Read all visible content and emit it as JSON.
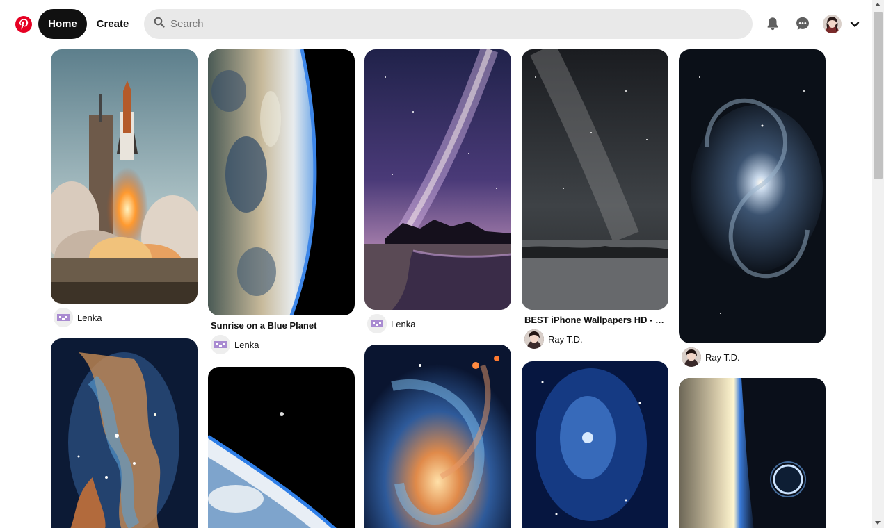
{
  "header": {
    "logo_icon": "pinterest-logo-icon",
    "home_label": "Home",
    "create_label": "Create",
    "search_placeholder": "Search",
    "icons": [
      "search-icon",
      "bell-icon",
      "chat-icon",
      "chevron-down-icon"
    ]
  },
  "colors": {
    "brand": "#e60023",
    "active_nav_bg": "#111111",
    "search_bg": "#e9e9e9"
  },
  "pins": [
    {
      "alt": "",
      "user": "Lenka",
      "title": ""
    },
    {
      "alt": "",
      "user": "Lenka",
      "title": "Sunrise on a Blue Planet"
    },
    {
      "alt": "",
      "user": "Lenka",
      "title": ""
    },
    {
      "alt": "",
      "user": "Ray T.D.",
      "title": "BEST iPhone Wallpapers HD - H..."
    },
    {
      "alt": "",
      "user": "Ray T.D.",
      "title": ""
    },
    {
      "alt": "",
      "user": "",
      "title": ""
    },
    {
      "alt": "",
      "user": "",
      "title": ""
    },
    {
      "alt": "",
      "user": "",
      "title": ""
    },
    {
      "alt": "",
      "user": "",
      "title": ""
    },
    {
      "alt": "",
      "user": "",
      "title": ""
    }
  ]
}
